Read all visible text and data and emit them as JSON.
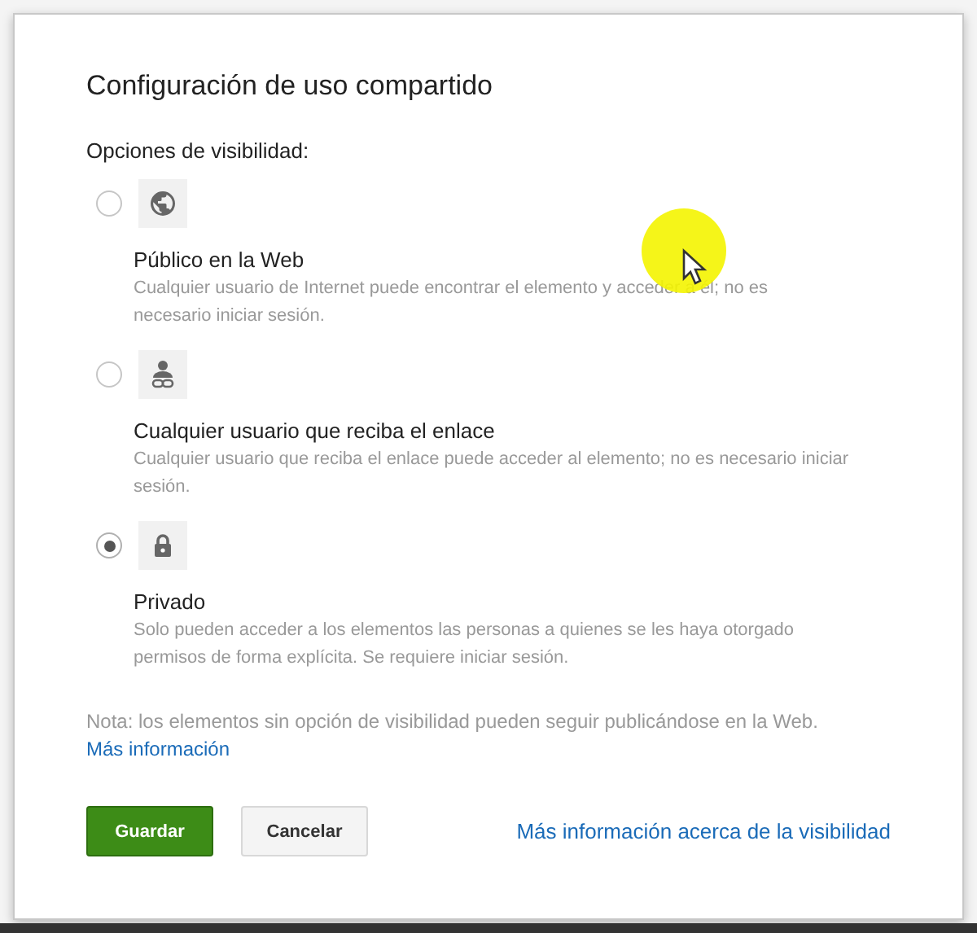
{
  "dialog": {
    "title": "Configuración de uso compartido",
    "section_label": "Opciones de visibilidad:",
    "options": [
      {
        "kind": "public",
        "label": "Público en la Web",
        "description": "Cualquier usuario de Internet puede encontrar el elemento y acceder a él; no es necesario iniciar sesión.",
        "selected": false
      },
      {
        "kind": "link",
        "label": "Cualquier usuario que reciba el enlace",
        "description": "Cualquier usuario que reciba el enlace puede acceder al elemento; no es necesario iniciar sesión.",
        "selected": false
      },
      {
        "kind": "private",
        "label": "Privado",
        "description": "Solo pueden acceder a los elementos las personas a quienes se les haya otorgado permisos de forma explícita. Se requiere iniciar sesión.",
        "selected": true
      }
    ],
    "note": "Nota: los elementos sin opción de visibilidad pueden seguir publicándose en la Web.",
    "note_link": "Más información",
    "save_button": "Guardar",
    "cancel_button": "Cancelar",
    "help_link": "Más información acerca de la visibilidad"
  }
}
